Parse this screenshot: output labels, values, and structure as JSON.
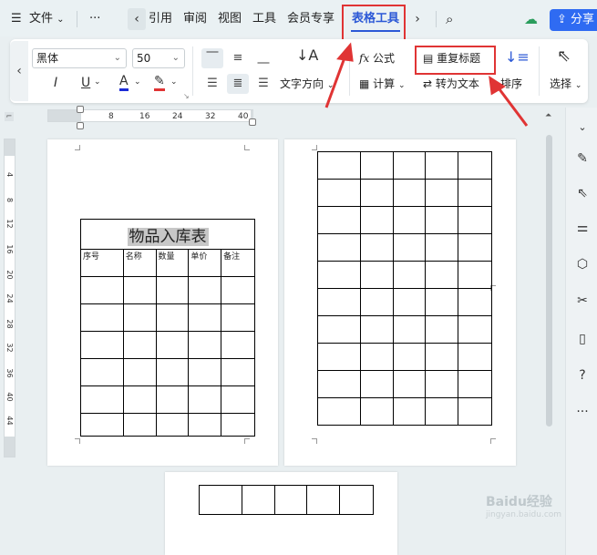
{
  "topbar": {
    "menu_icon": "menu-icon",
    "file_label": "文件",
    "more_label": "···",
    "tabs": [
      "引用",
      "审阅",
      "视图",
      "工具",
      "会员专享",
      "表格工具"
    ],
    "share_label": "分享"
  },
  "ribbon": {
    "font_name": "黑体",
    "font_size": "50",
    "text_direction_label": "文字方向",
    "formula_label": "公式",
    "calc_label": "计算",
    "repeat_header_label": "重复标题",
    "convert_text_label": "转为文本",
    "sort_label": "排序",
    "select_label": "选择"
  },
  "ruler": {
    "ticks": [
      "8",
      "16",
      "24",
      "32",
      "40"
    ]
  },
  "vruler": {
    "ticks": [
      "4",
      "8",
      "12",
      "16",
      "20",
      "24",
      "28",
      "32",
      "36",
      "40",
      "44"
    ]
  },
  "document": {
    "table_title": "物品入库表",
    "headers": [
      "序号",
      "名称",
      "数量",
      "单价",
      "备注"
    ]
  },
  "watermark": {
    "brand": "Baidu经验",
    "url": "jingyan.baidu.com"
  },
  "colors": {
    "accent": "#2b58d6",
    "share_button": "#2f6bf2",
    "highlight": "#e03434"
  }
}
